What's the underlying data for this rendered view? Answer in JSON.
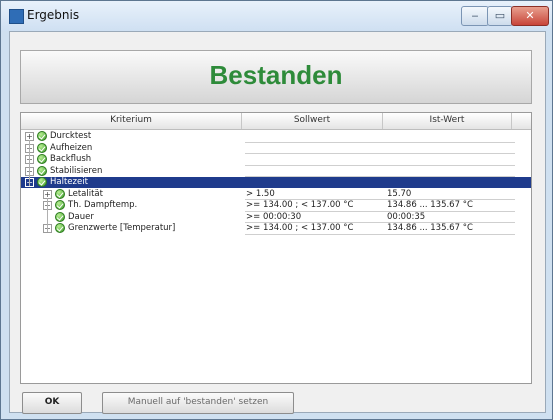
{
  "window": {
    "title": "Ergebnis",
    "app_icon": "app-icon",
    "min_label": "‒",
    "max_label": "▭",
    "close_label": "✕"
  },
  "banner": {
    "text": "Bestanden",
    "color": "#2e8b3a"
  },
  "grid": {
    "columns": [
      "Kriterium",
      "Sollwert",
      "Ist-Wert"
    ],
    "rows": [
      {
        "expander": "+",
        "label": "Durcktest",
        "soll": "",
        "ist": ""
      },
      {
        "expander": "+",
        "label": "Aufheizen",
        "soll": "",
        "ist": ""
      },
      {
        "expander": "+",
        "label": "Backflush",
        "soll": "",
        "ist": ""
      },
      {
        "expander": "+",
        "label": "Stabilisieren",
        "soll": "",
        "ist": ""
      },
      {
        "expander": "−",
        "label": "Haltezeit",
        "soll": "",
        "ist": "",
        "selected": true
      },
      {
        "expander": "+",
        "label": "Letalität",
        "soll": "> 1.50",
        "ist": "15.70"
      },
      {
        "expander": "+",
        "label": "Th. Dampftemp.",
        "soll": ">= 134.00 ; < 137.00 °C",
        "ist": "134.86 ... 135.67 °C"
      },
      {
        "expander": "",
        "label": "Dauer",
        "soll": ">= 00:00:30",
        "ist": "00:00:35"
      },
      {
        "expander": "+",
        "label": "Grenzwerte [Temperatur]",
        "soll": ">= 134.00 ; < 137.00 °C",
        "ist": "134.86 ... 135.67 °C"
      }
    ]
  },
  "buttons": {
    "ok": "OK",
    "manual": "Manuell auf 'bestanden' setzen"
  },
  "status_icon": "check-circle-icon"
}
